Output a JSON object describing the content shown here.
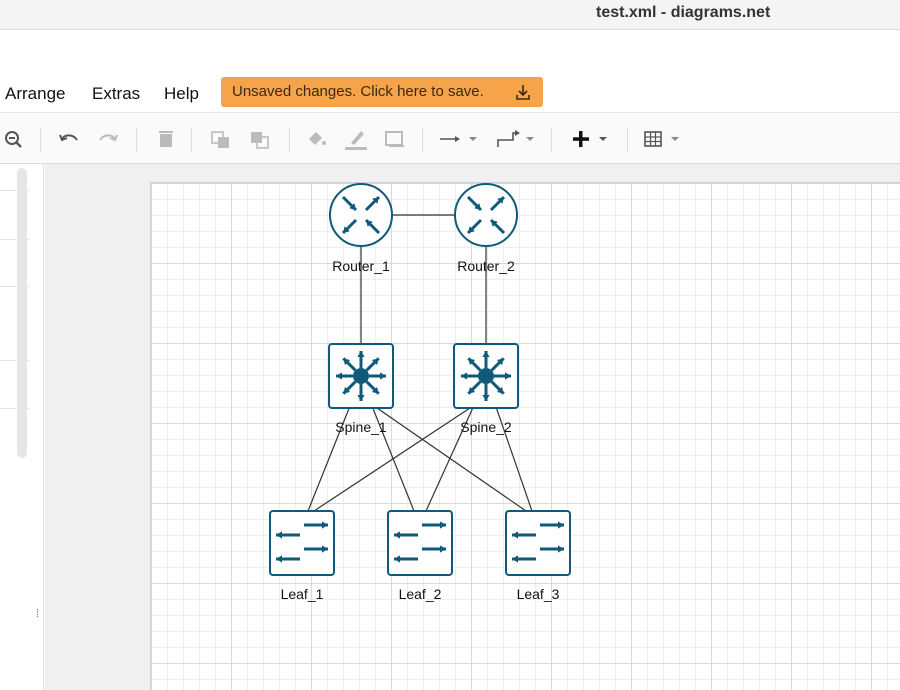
{
  "window": {
    "title": "test.xml - diagrams.net"
  },
  "menu": {
    "items": [
      {
        "label": "Arrange"
      },
      {
        "label": "Extras"
      },
      {
        "label": "Help"
      }
    ],
    "save_banner": "Unsaved changes. Click here to save."
  },
  "toolbar": {
    "tools": [
      "zoom-out",
      "undo",
      "redo",
      "delete",
      "to-front",
      "to-back",
      "fill-color",
      "line-color",
      "shadow",
      "connection",
      "waypoints",
      "insert",
      "table"
    ]
  },
  "diagram": {
    "nodes": [
      {
        "id": "router1",
        "label": "Router_1",
        "kind": "router"
      },
      {
        "id": "router2",
        "label": "Router_2",
        "kind": "router"
      },
      {
        "id": "spine1",
        "label": "Spine_1",
        "kind": "spine"
      },
      {
        "id": "spine2",
        "label": "Spine_2",
        "kind": "spine"
      },
      {
        "id": "leaf1",
        "label": "Leaf_1",
        "kind": "leaf"
      },
      {
        "id": "leaf2",
        "label": "Leaf_2",
        "kind": "leaf"
      },
      {
        "id": "leaf3",
        "label": "Leaf_3",
        "kind": "leaf"
      }
    ],
    "edges": [
      [
        "router1",
        "router2"
      ],
      [
        "router1",
        "spine1"
      ],
      [
        "router2",
        "spine2"
      ],
      [
        "spine1",
        "leaf1"
      ],
      [
        "spine1",
        "leaf2"
      ],
      [
        "spine1",
        "leaf3"
      ],
      [
        "spine2",
        "leaf1"
      ],
      [
        "spine2",
        "leaf2"
      ],
      [
        "spine2",
        "leaf3"
      ]
    ],
    "colors": {
      "icon": "#0e5a78",
      "icon_fill": "#ffffff",
      "edge": "#333333"
    }
  }
}
